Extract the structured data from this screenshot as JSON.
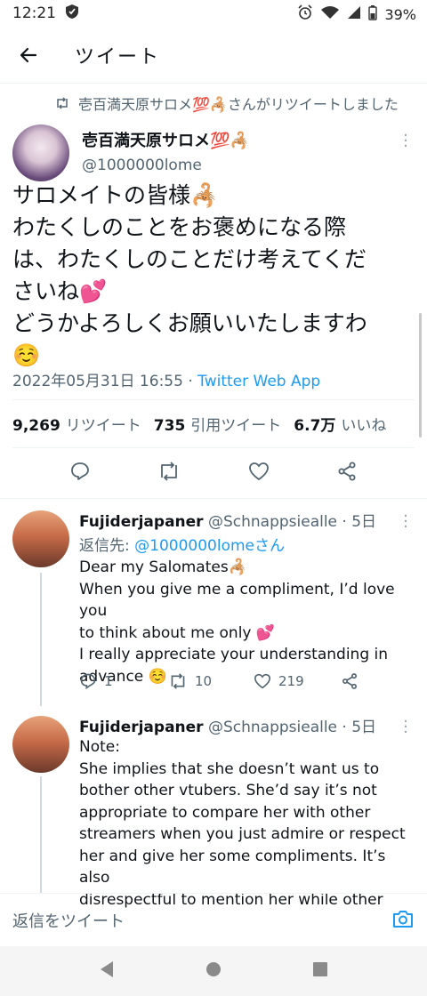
{
  "status_bar": {
    "time": "12:21",
    "battery": "39%"
  },
  "header": {
    "title": "ツイート"
  },
  "retweet_notice": {
    "text": "壱百満天原サロメ💯🦂さんがリツイートしました"
  },
  "tweet": {
    "author_name": "壱百満天原サロメ💯🦂",
    "author_handle": "@1000000lome",
    "lines": [
      "サロメイトの皆様🦂",
      "わたくしのことをお褒めになる際",
      "は、わたくしのことだけ考えてくだ",
      "さいね💕",
      "どうかよろしくお願いいたしますわ",
      "☺️"
    ],
    "date": "2022年05月31日 16:55 · ",
    "app": "Twitter Web App",
    "stats": [
      {
        "count": "9,269",
        "label": "リツイート"
      },
      {
        "count": "735",
        "label": "引用ツイート"
      },
      {
        "count": "6.7万",
        "label": "いいね"
      }
    ]
  },
  "replies": [
    {
      "name": "Fujiderjapaner",
      "handle": "@Schnappsiealle · 5日",
      "reply_to_label": "返信先: ",
      "reply_to_link": "@1000000lomeさん",
      "lines": [
        "Dear my Salomates🦂",
        "When you give me a compliment, I’d love you",
        "to think about me only 💕",
        "I really appreciate your understanding in",
        "advance ☺️"
      ],
      "reply_count": "1",
      "retweet_count": "10",
      "like_count": "219"
    },
    {
      "name": "Fujiderjapaner",
      "handle": "@Schnappsiealle · 5日",
      "lines": [
        "Note:",
        "She implies that she doesn’t want us to",
        "bother other vtubers. She’d say it’s not",
        "appropriate to compare her with other",
        "streamers when you just admire or respect",
        "her and give her some compliments. It’s also",
        "disrespectful to mention her while other"
      ]
    }
  ],
  "compose": {
    "placeholder": "返信をツイート"
  },
  "colors": {
    "accent": "#1d9bf0",
    "muted": "#536471",
    "like_pink": "#f91880"
  },
  "icons": [
    "back-arrow-icon",
    "retweet-icon",
    "more-icon",
    "reply-icon",
    "like-icon",
    "share-icon",
    "camera-icon",
    "nav-back-icon",
    "nav-home-icon",
    "nav-recents-icon"
  ]
}
